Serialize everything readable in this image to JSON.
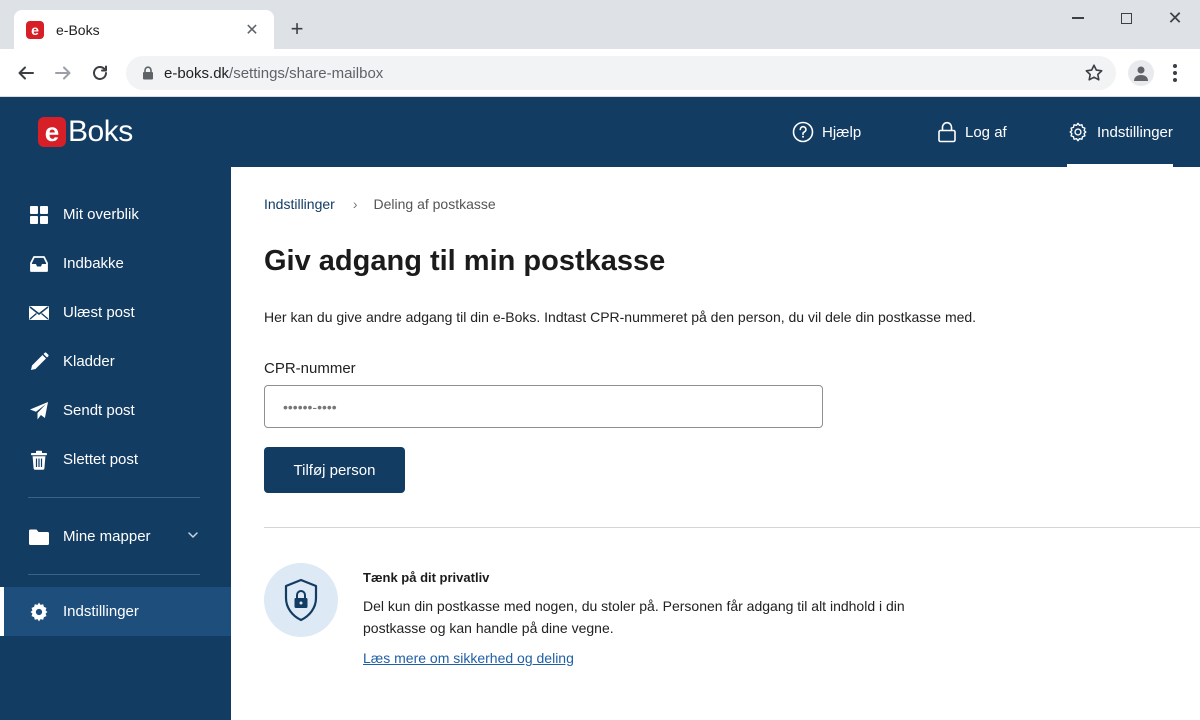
{
  "browser": {
    "tab_title": "e-Boks",
    "tab_favicon_letter": "e",
    "url_domain": "e-boks.dk",
    "url_path": "/settings/share-mailbox",
    "new_tab_symbol": "+",
    "close_tab_symbol": "✕",
    "close_window_symbol": "✕"
  },
  "header": {
    "logo_e": "e",
    "logo_text": "Boks",
    "nav": {
      "help": "Hjælp",
      "logout": "Log af",
      "settings": "Indstillinger"
    }
  },
  "sidebar": {
    "items": [
      {
        "label": "Mit overblik",
        "icon": "dashboard-icon"
      },
      {
        "label": "Indbakke",
        "icon": "inbox-icon"
      },
      {
        "label": "Ulæst post",
        "icon": "envelope-icon"
      },
      {
        "label": "Kladder",
        "icon": "pencil-icon"
      },
      {
        "label": "Sendt post",
        "icon": "send-icon"
      },
      {
        "label": "Slettet post",
        "icon": "trash-icon"
      }
    ],
    "folders": {
      "label": "Mine mapper",
      "icon": "folder-icon"
    },
    "settings": {
      "label": "Indstillinger",
      "icon": "gear-icon",
      "active": true
    }
  },
  "main": {
    "breadcrumb": {
      "parent": "Indstillinger",
      "separator": "›",
      "current": "Deling af postkasse"
    },
    "title": "Giv adgang til min postkasse",
    "intro": "Her kan du give andre adgang til din e-Boks. Indtast CPR-nummeret på den person, du vil dele din postkasse med.",
    "cpr": {
      "label": "CPR-nummer",
      "placeholder": "••••••-••••"
    },
    "add_button": "Tilføj person",
    "privacy": {
      "title": "Tænk på dit privatliv",
      "text": "Del kun din postkasse med nogen, du stoler på. Personen får adgang til alt indhold i din postkasse og kan handle på dine vegne.",
      "link": "Læs mere om sikkerhed og deling"
    }
  },
  "colors": {
    "brand_navy": "#133c63",
    "brand_red": "#d61f26",
    "active_item": "#1e4e7c",
    "shield_bg": "#dde9f5",
    "link": "#1f5fa6"
  }
}
